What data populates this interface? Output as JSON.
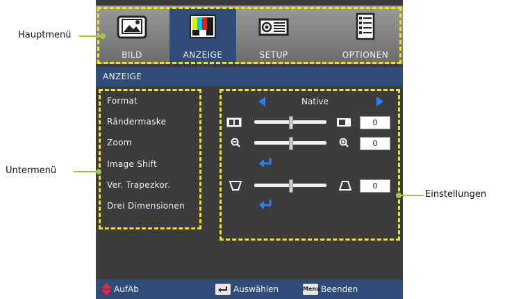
{
  "callouts": {
    "main_menu": "Hauptmenü",
    "sub_menu": "Untermenü",
    "settings": "Einstellungen"
  },
  "tabs": [
    {
      "label": "BILD",
      "icon": "picture-icon"
    },
    {
      "label": "ANZEIGE",
      "icon": "display-icon",
      "active": true
    },
    {
      "label": "SETUP",
      "icon": "projector-icon"
    },
    {
      "label": "OPTIONEN",
      "icon": "options-icon"
    }
  ],
  "header": {
    "title": "ANZEIGE"
  },
  "menu": {
    "items": [
      "Format",
      "Rändermaske",
      "Zoom",
      "Image Shift",
      "Ver. Trapezkor.",
      "Drei Dimensionen"
    ]
  },
  "settings": {
    "format_value": "Native",
    "edge_mask": {
      "value": "0",
      "position": 0.5
    },
    "zoom": {
      "value": "0",
      "position": 0.5
    },
    "keystone": {
      "value": "0",
      "position": 0.5
    }
  },
  "footer": {
    "updown": "AufAb",
    "select": "Auswählen",
    "menu_badge": "Menu",
    "exit": "Beenden"
  },
  "colors": {
    "accent": "#2f4d78",
    "highlight": "#f3e21d",
    "callout": "#9ccc3c"
  }
}
